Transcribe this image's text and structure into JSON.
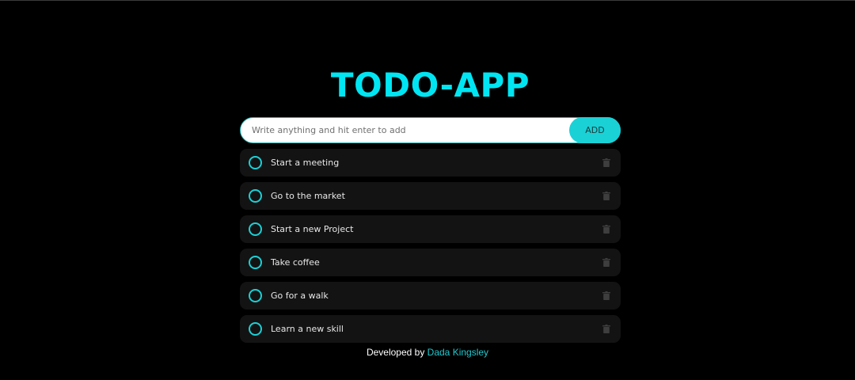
{
  "app": {
    "title": "TODO-APP"
  },
  "input": {
    "placeholder": "Write anything and hit enter to add",
    "value": "",
    "add_label": "ADD"
  },
  "todos": [
    {
      "text": "Start a meeting",
      "done": false
    },
    {
      "text": "Go to the market",
      "done": false
    },
    {
      "text": "Start a new Project",
      "done": false
    },
    {
      "text": "Take coffee",
      "done": false
    },
    {
      "text": "Go for a walk",
      "done": false
    },
    {
      "text": "Learn a new skill",
      "done": false
    }
  ],
  "footer": {
    "prefix": "Developed by",
    "author": "Dada Kingsley"
  },
  "colors": {
    "accent": "#00e5f2",
    "button": "#1ad1d6",
    "item_bg": "#141313",
    "background": "#000000"
  },
  "icons": {
    "check": "circle-outline-icon",
    "delete": "trash-icon"
  }
}
